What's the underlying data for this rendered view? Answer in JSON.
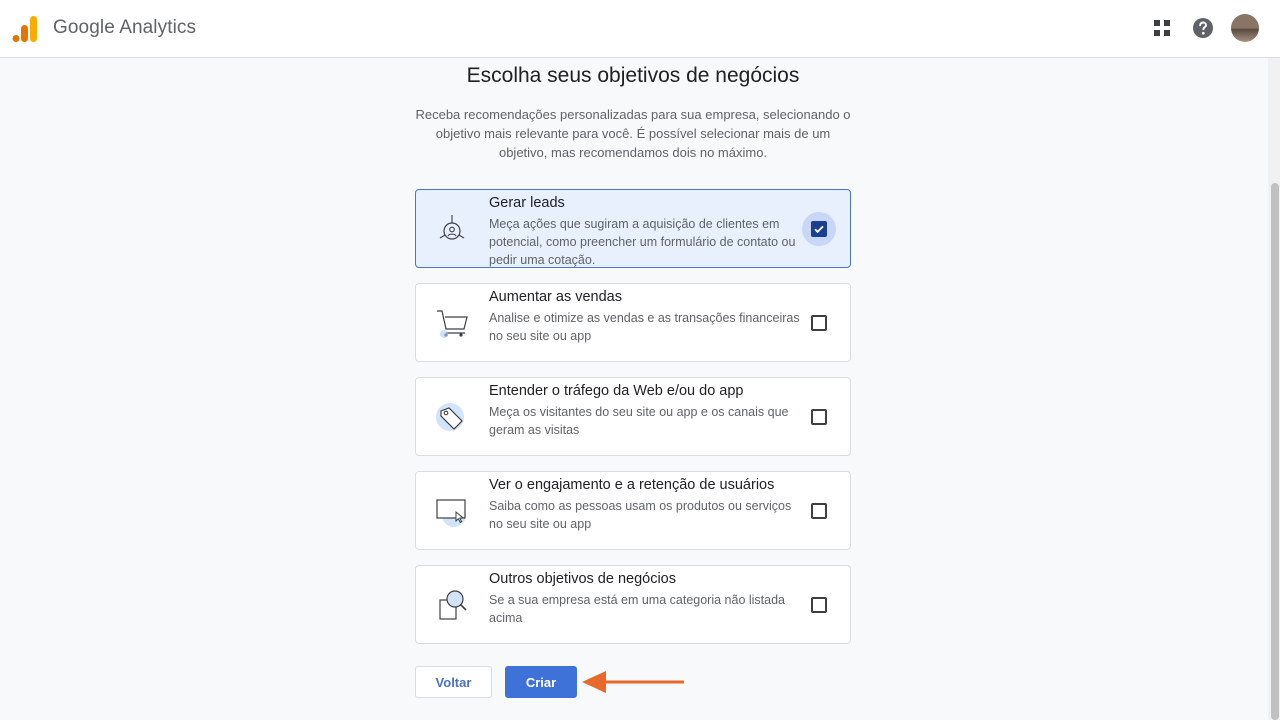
{
  "app": {
    "product_name": "Google Analytics",
    "icons": [
      "analytics-logo",
      "apps-grid-icon",
      "help-icon",
      "avatar"
    ]
  },
  "page": {
    "title": "Escolha seus objetivos de negócios",
    "description": "Receba recomendações personalizadas para sua empresa, selecionando o objetivo mais relevante para você. É possível selecionar mais de um objetivo, mas recomendamos dois no máximo."
  },
  "options": [
    {
      "title": "Gerar leads",
      "description": "Meça ações que sugiram a aquisição de clientes em potencial, como preencher um formulário de contato ou pedir uma cotação.",
      "icon": "target-person-icon",
      "checked": true
    },
    {
      "title": "Aumentar as vendas",
      "description": "Analise e otimize as vendas e as transações financeiras no seu site ou app",
      "icon": "shopping-cart-icon",
      "checked": false
    },
    {
      "title": "Entender o tráfego da Web e/ou do app",
      "description": "Meça os visitantes do seu site ou app e os canais que geram as visitas",
      "icon": "tag-icon",
      "checked": false
    },
    {
      "title": "Ver o engajamento e a retenção de usuários",
      "description": "Saiba como as pessoas usam os produtos ou serviços no seu site ou app",
      "icon": "screen-cursor-icon",
      "checked": false
    },
    {
      "title": "Outros objetivos de negócios",
      "description": "Se a sua empresa está em uma categoria não listada acima",
      "icon": "magnifier-icon",
      "checked": false
    }
  ],
  "actions": {
    "back_label": "Voltar",
    "create_label": "Criar"
  },
  "colors": {
    "accent": "#3f72d8",
    "selected_bg": "#e8f0fe",
    "annotation_arrow": "#e8692b"
  }
}
